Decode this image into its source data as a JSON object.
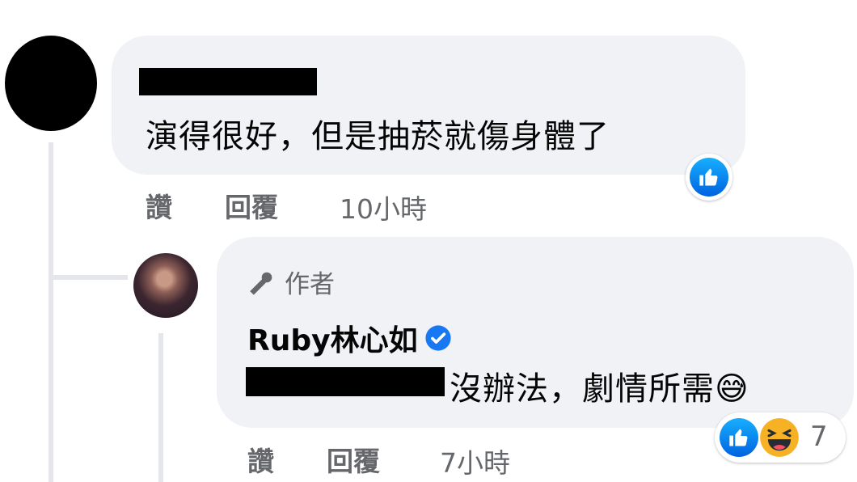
{
  "comment1": {
    "author_redacted": true,
    "text": "演得很好，但是抽菸就傷身體了",
    "actions": {
      "like": "讚",
      "reply": "回覆"
    },
    "timestamp": "10小時",
    "reaction_icon": "like-icon"
  },
  "reply1": {
    "badge": "作者",
    "author": "Ruby林心如",
    "verified_icon": "verified-badge-icon",
    "mention_redacted": true,
    "text": "沒辦法，劇情所需😅",
    "actions": {
      "like": "讚",
      "reply": "回覆"
    },
    "timestamp": "7小時",
    "reactions": [
      "like-icon",
      "laugh-icon"
    ],
    "reaction_count": "7"
  },
  "colors": {
    "bubble": "#f0f2f5",
    "secondary_text": "#65676b",
    "like_blue": "#0866ff",
    "verified_blue": "#1877f2",
    "thread_line": "#e4e6eb"
  }
}
